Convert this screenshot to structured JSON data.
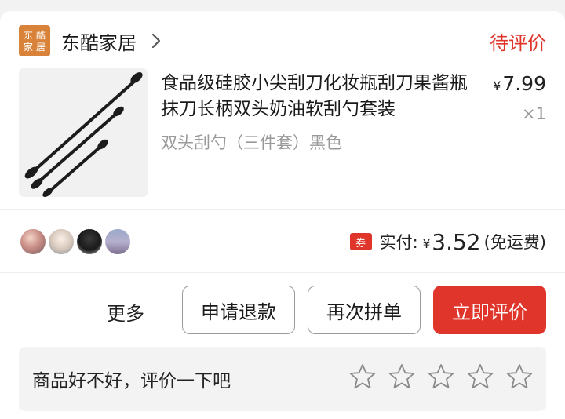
{
  "shop": {
    "logo_chars": [
      "东",
      "酷",
      "家",
      "居"
    ],
    "name": "东酷家居",
    "order_status": "待评价"
  },
  "product": {
    "title": "食品级硅胶小尖刮刀化妆瓶刮刀果酱瓶抹刀长柄双头奶油软刮勺套装",
    "price_currency": "¥",
    "price": "7.99",
    "quantity": "×1",
    "sku": "双头刮勺（三件套）黑色"
  },
  "payment": {
    "coupon_icon_text": "券",
    "label": "实付:",
    "currency": "¥",
    "amount": "3.52",
    "note": "(免运费)"
  },
  "actions": {
    "more": "更多",
    "refund": "申请退款",
    "reorder": "再次拼单",
    "review": "立即评价"
  },
  "review": {
    "prompt": "商品好不好，评价一下吧",
    "star_count": 5
  },
  "colors": {
    "accent": "#e0352b",
    "logo_bg": "#d8823a"
  }
}
